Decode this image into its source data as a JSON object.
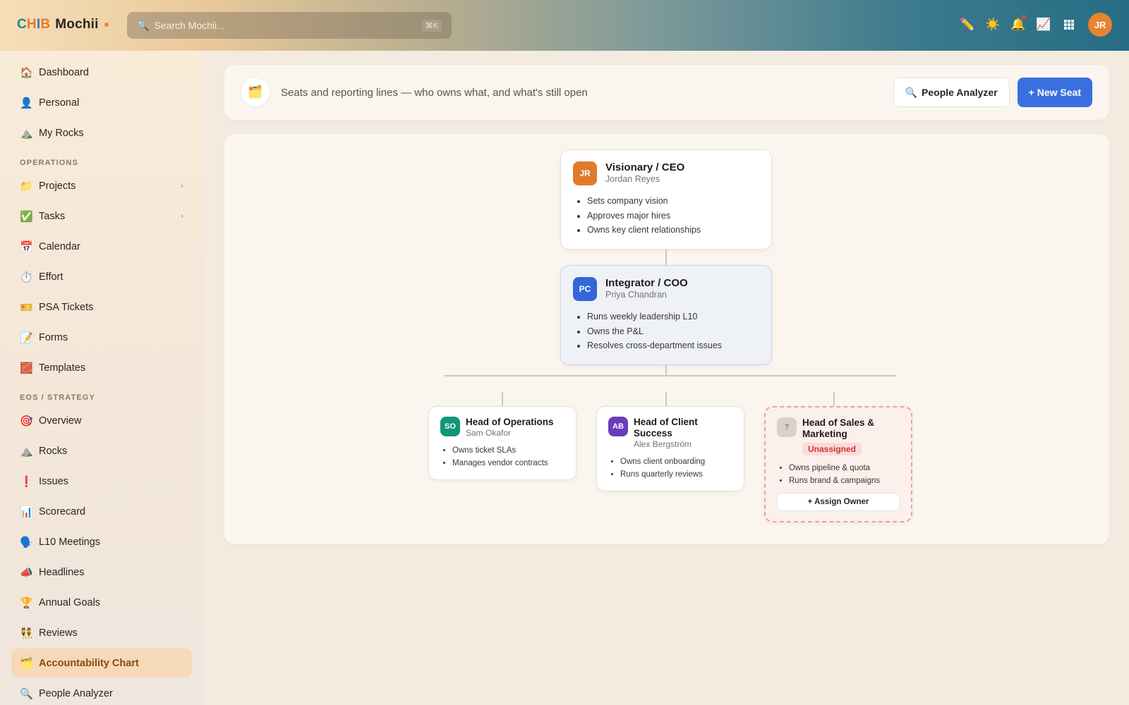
{
  "app": {
    "brand_letters": [
      "C",
      "H",
      "I",
      "B"
    ],
    "brand_letter_colors": [
      "#1e8a82",
      "#e8792a",
      "#2f7fc4",
      "#e8792a"
    ],
    "name": "Mochii"
  },
  "search": {
    "placeholder": "Search Mochii...",
    "shortcut": "⌘K"
  },
  "topbar": {
    "icons": [
      "pencil-icon",
      "sun-icon",
      "bell-icon",
      "chart-icon",
      "grid-icon"
    ],
    "user_initials": "JR"
  },
  "sidebar": {
    "items": [
      {
        "label": "Dashboard",
        "icon": "🏠"
      },
      {
        "label": "Personal",
        "icon": "👤"
      },
      {
        "label": "My Rocks",
        "icon": "⛰️"
      }
    ],
    "operations_title": "OPERATIONS",
    "operations": [
      {
        "label": "Projects",
        "icon": "📁",
        "chevron": "›"
      },
      {
        "label": "Tasks",
        "icon": "✅",
        "chevron": "›"
      },
      {
        "label": "Calendar",
        "icon": "📅"
      },
      {
        "label": "Effort",
        "icon": "⏱️"
      },
      {
        "label": "PSA Tickets",
        "icon": "🎫"
      },
      {
        "label": "Forms",
        "icon": "📝"
      },
      {
        "label": "Templates",
        "icon": "🧱"
      }
    ],
    "strategy_title": "EOS / STRATEGY",
    "strategy": [
      {
        "label": "Overview",
        "icon": "🎯"
      },
      {
        "label": "Rocks",
        "icon": "⛰️"
      },
      {
        "label": "Issues",
        "icon": "❗"
      },
      {
        "label": "Scorecard",
        "icon": "📊"
      },
      {
        "label": "L10 Meetings",
        "icon": "🗣️"
      },
      {
        "label": "Headlines",
        "icon": "📣"
      },
      {
        "label": "Annual Goals",
        "icon": "🏆"
      },
      {
        "label": "Reviews",
        "icon": "👯"
      },
      {
        "label": "Accountability Chart",
        "icon": "🗂️",
        "active": true
      },
      {
        "label": "People Analyzer",
        "icon": "🔍"
      }
    ]
  },
  "header": {
    "icon": "🗂️",
    "subtitle": "Seats and reporting lines — who owns what, and what's still open",
    "people_analyzer_label": "People Analyzer",
    "new_seat_label": "+ New Seat"
  },
  "chart": {
    "ceo": {
      "title": "Visionary / CEO",
      "person": "Jordan Reyes",
      "initials": "JR",
      "color": "#e07b2c",
      "responsibilities": [
        "Sets company vision",
        "Approves major hires",
        "Owns key client relationships"
      ]
    },
    "coo": {
      "title": "Integrator / COO",
      "person": "Priya Chandran",
      "initials": "PC",
      "color": "#3366d6",
      "responsibilities": [
        "Runs weekly leadership L10",
        "Owns the P&L",
        "Resolves cross-department issues"
      ]
    },
    "ops": {
      "title": "Head of Operations",
      "person": "Sam Okafor",
      "initials": "SO",
      "color": "#129478",
      "responsibilities": [
        "Owns ticket SLAs",
        "Manages vendor contracts"
      ]
    },
    "cs": {
      "title": "Head of Client Success",
      "person": "Alex Bergström",
      "initials": "AB",
      "color": "#6a3db8",
      "responsibilities": [
        "Owns client onboarding",
        "Runs quarterly reviews"
      ]
    },
    "sales": {
      "title": "Head of Sales & Marketing",
      "status": "Unassigned",
      "initials": "?",
      "color": "#d9d2cc",
      "responsibilities": [
        "Owns pipeline & quota",
        "Runs brand & campaigns"
      ],
      "assign_label": "+ Assign Owner"
    }
  }
}
